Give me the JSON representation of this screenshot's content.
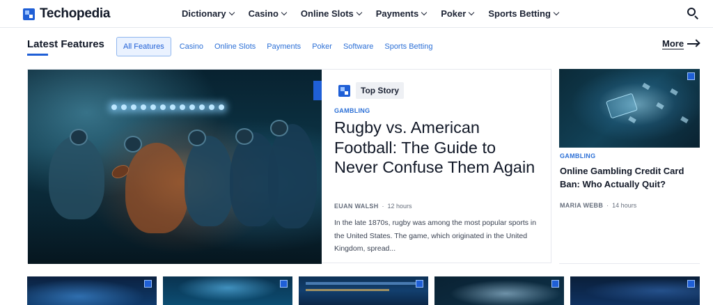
{
  "header": {
    "brand": "Techopedia",
    "nav": [
      {
        "label": "Dictionary"
      },
      {
        "label": "Casino"
      },
      {
        "label": "Online Slots"
      },
      {
        "label": "Payments"
      },
      {
        "label": "Poker"
      },
      {
        "label": "Sports Betting"
      }
    ],
    "search_icon": "search-icon"
  },
  "features": {
    "title": "Latest Features",
    "filters": [
      "All Features",
      "Casino",
      "Online Slots",
      "Payments",
      "Poker",
      "Software",
      "Sports Betting"
    ],
    "active_filter": "All Features",
    "more_label": "More"
  },
  "hero": {
    "tag": "Top Story",
    "category": "GAMBLING",
    "headline": "Rugby vs. American Football: The Guide to Never Confuse Them Again",
    "author": "EUAN WALSH",
    "separator": "·",
    "time": "12 hours",
    "excerpt": "In the late 1870s, rugby was among the most popular sports in the United States. The game, which originated in the United Kingdom, spread..."
  },
  "side_story": {
    "category": "GAMBLING",
    "title": "Online Gambling Credit Card Ban: Who Actually Quit?",
    "author": "MARIA WEBB",
    "separator": "·",
    "time": "14 hours"
  },
  "colors": {
    "accent": "#1f5fd6",
    "link": "#2b6fd6",
    "text": "#111827"
  }
}
